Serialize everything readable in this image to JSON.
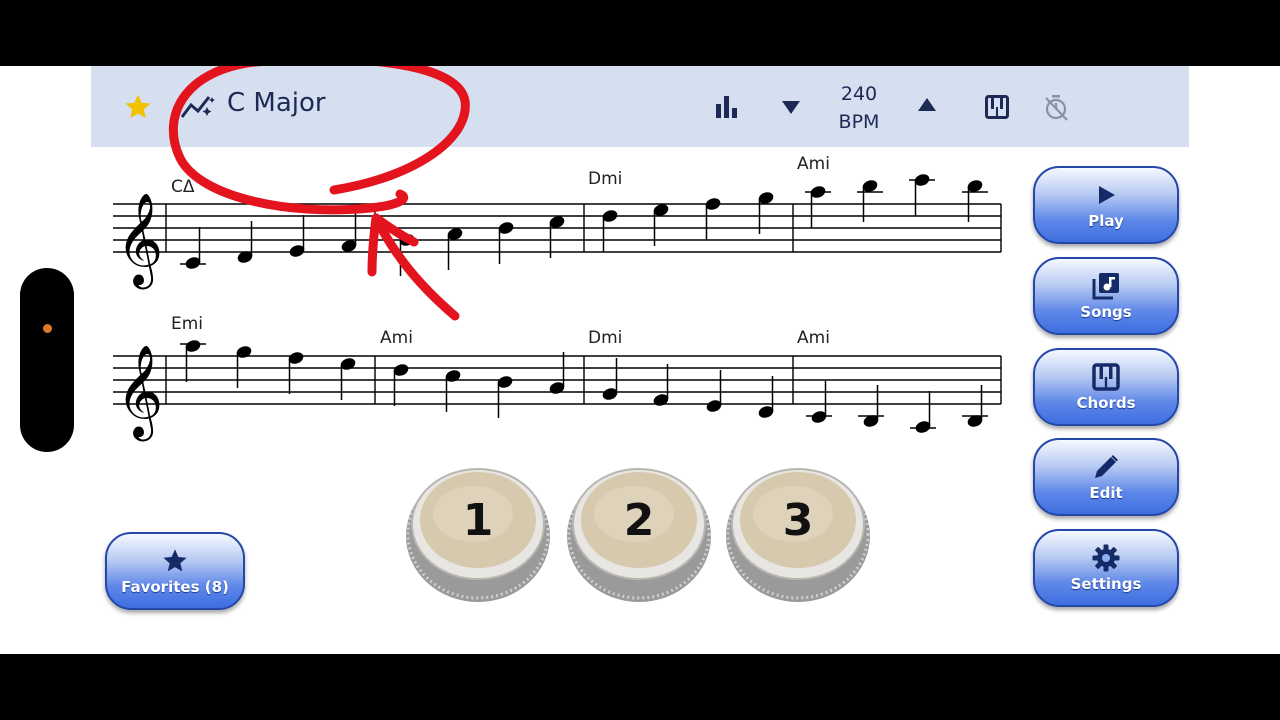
{
  "header": {
    "title": "C Major",
    "tempo_value": "240",
    "tempo_unit": "BPM"
  },
  "score": {
    "row1_chords": [
      "CΔ",
      "Dmi",
      "Ami"
    ],
    "row2_chords": [
      "Emi",
      "Ami",
      "Dmi",
      "Ami"
    ]
  },
  "buttons": {
    "play": "Play",
    "songs": "Songs",
    "chords": "Chords",
    "edit": "Edit",
    "settings": "Settings",
    "favorites": "Favorites (8)"
  },
  "knobs": [
    "1",
    "2",
    "3"
  ],
  "colors": {
    "header_bg": "#d6dff0",
    "accent_text": "#1c2a55",
    "star": "#f2c200",
    "button_blue": "#3e6ee0",
    "annotation_red": "#e3141e"
  },
  "icons": {
    "favorite": "star-icon",
    "scale": "scale-graph-icon",
    "bars": "bar-chart-icon",
    "tempo_down": "triangle-down-icon",
    "tempo_up": "triangle-up-icon",
    "piano": "piano-icon",
    "timer": "timer-off-icon"
  }
}
